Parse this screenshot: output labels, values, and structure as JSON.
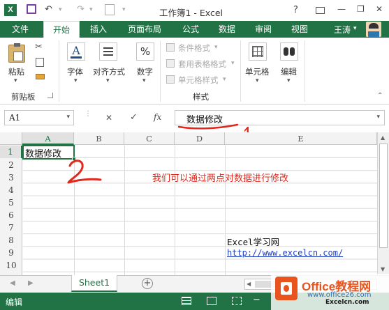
{
  "titlebar": {
    "title": "工作簿1 - Excel",
    "help": "?",
    "minimize": "—",
    "restore": "❐",
    "close": "✕"
  },
  "tabs": [
    {
      "label": "文件"
    },
    {
      "label": "开始"
    },
    {
      "label": "插入"
    },
    {
      "label": "页面布局"
    },
    {
      "label": "公式"
    },
    {
      "label": "数据"
    },
    {
      "label": "审阅"
    },
    {
      "label": "视图"
    }
  ],
  "user": {
    "name": "王涛"
  },
  "ribbon": {
    "paste": "粘贴",
    "clipboard_group": "剪贴板",
    "font": "字体",
    "alignment": "对齐方式",
    "number": "数字",
    "number_symbol": "%",
    "conditional_format": "条件格式",
    "table_format": "套用表格格式",
    "cell_styles": "单元格样式",
    "styles_group": "样式",
    "cells": "单元格",
    "editing": "编辑"
  },
  "formula_bar": {
    "name_box": "A1",
    "cancel": "✕",
    "confirm": "✓",
    "fx": "fx",
    "content": "数据修改"
  },
  "grid": {
    "columns": [
      "A",
      "B",
      "C",
      "D",
      "E"
    ],
    "rows": [
      "1",
      "2",
      "3",
      "4",
      "5",
      "6",
      "7",
      "8",
      "9",
      "10"
    ],
    "a1": "数据修改",
    "note": "我们可以通过两点对数据进行修改",
    "site_name": "Excel学习网",
    "site_url": "http://www.excelcn.com/"
  },
  "annotations": {
    "one": "1",
    "two": "2"
  },
  "sheetbar": {
    "sheet": "Sheet1",
    "add": "+"
  },
  "status": {
    "mode": "编辑"
  },
  "watermark": {
    "brand": "Office教程网",
    "url": "www.office26.com",
    "small": "Excelcn.com"
  },
  "colors": {
    "excel_green": "#217346",
    "note_red": "#e0281c",
    "link_blue": "#1f3fbf"
  }
}
